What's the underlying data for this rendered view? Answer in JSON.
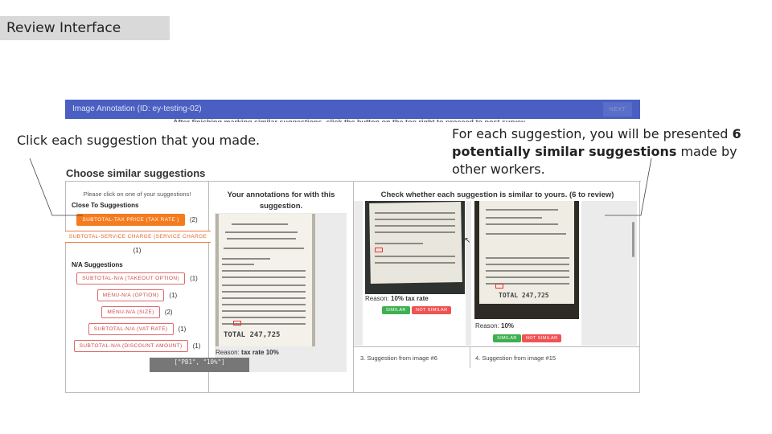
{
  "slide": {
    "title": "Review Interface"
  },
  "app": {
    "title": "Image Annotation (ID: ey-testing-02)",
    "next_label": "NEXT",
    "subnote": "After finishing marking similar suggestions, click the button on the top right to proceed to post survey."
  },
  "callouts": {
    "left": "Click each suggestion that you made.",
    "right_prefix": "For each suggestion, you will be presented ",
    "right_bold": "6 potentially similar suggestions",
    "right_suffix": " made by other workers."
  },
  "choose_title": "Choose similar suggestions",
  "left_panel": {
    "hint": "Please click on one of your suggestions!",
    "close_title": "Close To Suggestions",
    "close_items": [
      {
        "label": "SUBTOTAL-TAX PRICE (TAX RATE )",
        "count": "(2)",
        "selected": true
      },
      {
        "label": "SUBTOTAL-SERVICE CHARGE (SERVICE CHARGE",
        "count": "(1)",
        "selected": false
      }
    ],
    "na_title": "N/A Suggestions",
    "na_items": [
      {
        "label": "SUBTOTAL-N/A (TAKEOUT OPTION)",
        "count": "(1)"
      },
      {
        "label": "MENU-N/A (OPTION)",
        "count": "(1)"
      },
      {
        "label": "MENU-N/A (SIZE)",
        "count": "(2)"
      },
      {
        "label": "SUBTOTAL-N/A (VAT RATE)",
        "count": "(1)"
      },
      {
        "label": "SUBTOTAL-N/A (DISCOUNT AMOUNT)",
        "count": "(1)"
      }
    ]
  },
  "middle_panel": {
    "header": "Your annotations for with this suggestion.",
    "reason_prefix": "Reason: ",
    "reason_value": "tax rate 10%",
    "code": "[\"PB1\", \"10%\"]",
    "receipt_total": "TOTAL        247,725"
  },
  "right_panel": {
    "header": "Check whether each suggestion is similar to yours. (6 to review)",
    "cards": [
      {
        "reason_prefix": "Reason: ",
        "reason_value": "10% tax rate",
        "similar": "SIMILAR",
        "not_similar": "NOT SIMILAR"
      },
      {
        "reason_prefix": "Reason: ",
        "reason_value": "10%",
        "similar": "SIMILAR",
        "not_similar": "NOT SIMILAR",
        "receipt_total": "TOTAL     247,725"
      }
    ],
    "next_labels": [
      "3. Suggestion from image #6",
      "4. Suggestion from image #15"
    ]
  },
  "colors": {
    "topbar": "#4a5fc1",
    "selected_chip": "#f57b1f",
    "similar": "#3fb050",
    "not_similar": "#ef5353"
  }
}
